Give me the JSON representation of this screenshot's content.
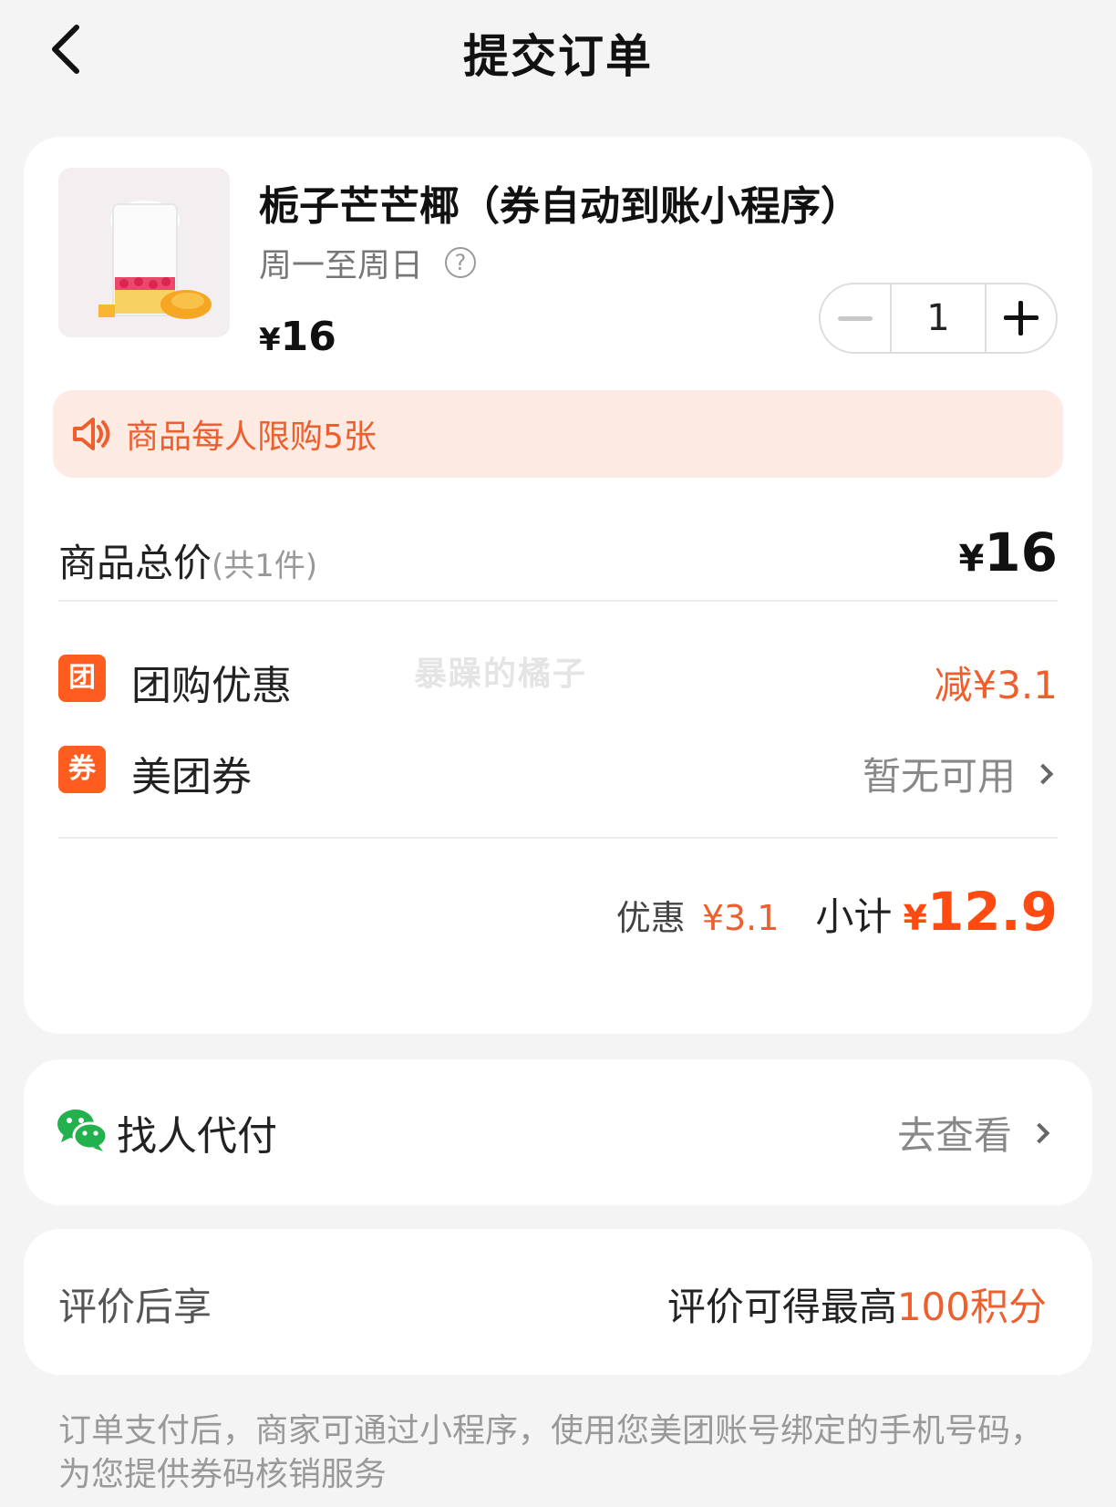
{
  "header": {
    "title": "提交订单"
  },
  "product": {
    "name": "栀子芒芒椰（券自动到账小程序）",
    "validity": "周一至周日",
    "help_icon": "?",
    "price_symbol": "¥",
    "price": "16",
    "quantity": "1"
  },
  "notice": {
    "text": "商品每人限购5张"
  },
  "total": {
    "label": "商品总价",
    "count": "(共1件)",
    "symbol": "¥",
    "amount": "16"
  },
  "discounts": [
    {
      "tag": "团",
      "label": "团购优惠",
      "value": "减¥3.1"
    },
    {
      "tag": "券",
      "label": "美团券",
      "value": "暂无可用"
    }
  ],
  "watermark": "暴躁的橘子",
  "subtotal": {
    "discount_label": "优惠",
    "discount_value": "¥3.1",
    "sum_label": "小计",
    "symbol": "¥",
    "amount": "12.9"
  },
  "pay_for_me": {
    "label": "找人代付",
    "action": "去查看"
  },
  "review": {
    "label": "评价后享",
    "value_prefix": "评价可得最高",
    "value_highlight": "100积分"
  },
  "footer": {
    "text": "订单支付后，商家可通过小程序，使用您美团账号绑定的手机号码，为您提供券码核销服务"
  },
  "colors": {
    "accent": "#ee5f2e",
    "price_red": "#ff4a12",
    "tag_bg": "#ff5c1f",
    "notice_bg": "#fdeae2",
    "wechat_green": "#22b14c"
  },
  "icons": [
    "back-arrow-icon",
    "help-icon",
    "minus-icon",
    "plus-icon",
    "speaker-icon",
    "chevron-right-icon",
    "wechat-icon"
  ]
}
